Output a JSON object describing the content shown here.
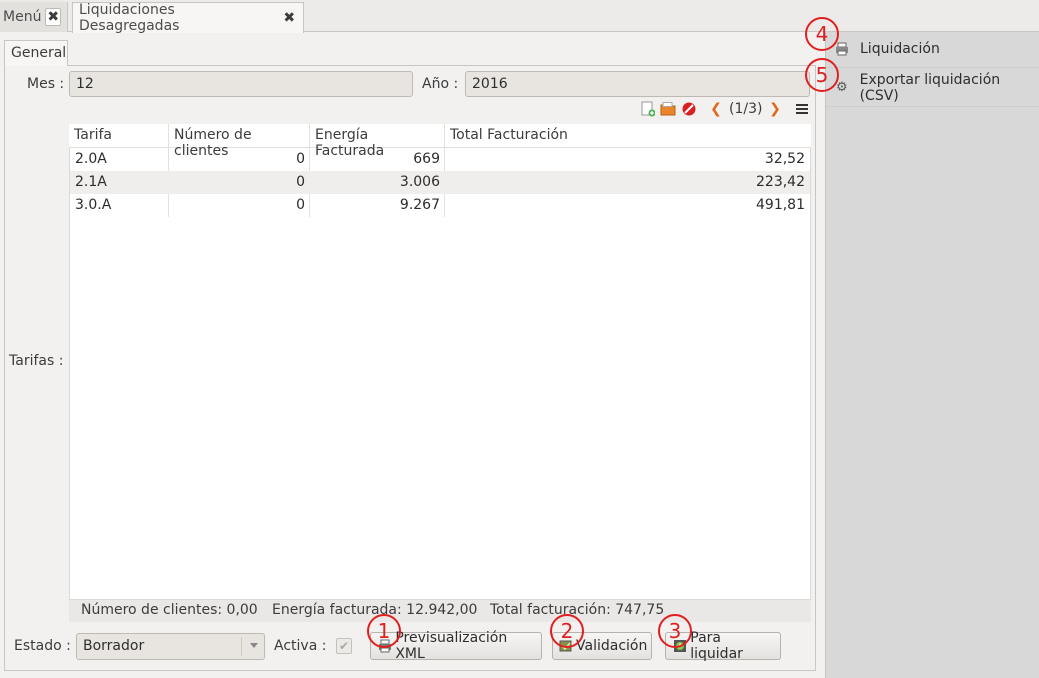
{
  "tabs": [
    {
      "label": "Menú"
    },
    {
      "label": "Liquidaciones Desagregadas"
    }
  ],
  "subtab": {
    "label": "General"
  },
  "form": {
    "mes_label": "Mes :",
    "mes_value": "12",
    "anio_label": "Año :",
    "anio_value": "2016",
    "tarifas_label": "Tarifas :",
    "estado_label": "Estado :",
    "estado_value": "Borrador",
    "activa_label": "Activa :"
  },
  "toolbar": {
    "pager": "(1/3)"
  },
  "table": {
    "headers": [
      "Tarifa",
      "Número de clientes",
      "Energía Facturada",
      "Total Facturación"
    ],
    "rows": [
      [
        "2.0A",
        "0",
        "669",
        "32,52"
      ],
      [
        "2.1A",
        "0",
        "3.006",
        "223,42"
      ],
      [
        "3.0.A",
        "0",
        "9.267",
        "491,81"
      ]
    ]
  },
  "summary": {
    "clientes": "Número de clientes: 0,00",
    "energia": "Energía facturada: 12.942,00",
    "total": "Total facturación: 747,75"
  },
  "buttons": {
    "previsualizacion": "Previsualización XML",
    "validacion": "Validación",
    "para_liquidar": "Para liquidar"
  },
  "side_actions": [
    {
      "label": "Liquidación",
      "icon": "printer-icon"
    },
    {
      "label": "Exportar liquidación (CSV)",
      "icon": "gear-icon"
    }
  ],
  "markers": [
    "1",
    "2",
    "3",
    "4",
    "5"
  ],
  "colors": {
    "marker": "#e02020",
    "side_panel": "#d8d8d8"
  }
}
